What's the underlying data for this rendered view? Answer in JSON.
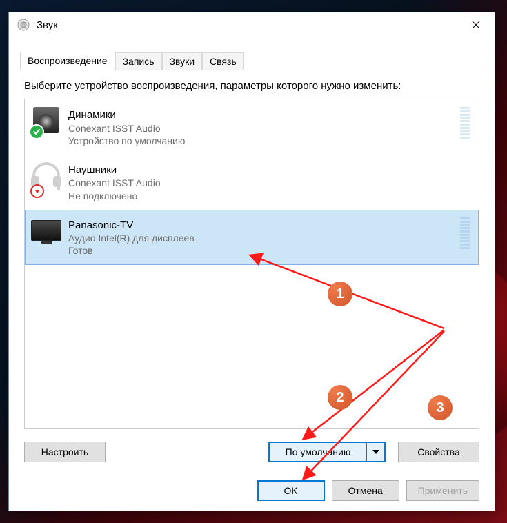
{
  "window": {
    "title": "Звук"
  },
  "tabs": {
    "items": [
      {
        "label": "Воспроизведение",
        "active": true
      },
      {
        "label": "Запись",
        "active": false
      },
      {
        "label": "Звуки",
        "active": false
      },
      {
        "label": "Связь",
        "active": false
      }
    ]
  },
  "instruction": "Выберите устройство воспроизведения, параметры которого нужно изменить:",
  "devices": [
    {
      "name": "Динамики",
      "subtitle": "Conexant ISST Audio",
      "status": "Устройство по умолчанию",
      "icon": "speakers",
      "badge": "check",
      "selected": false
    },
    {
      "name": "Наушники",
      "subtitle": "Conexant ISST Audio",
      "status": "Не подключено",
      "icon": "headphones",
      "badge": "down",
      "selected": false
    },
    {
      "name": "Panasonic-TV",
      "subtitle": "Аудио Intel(R) для дисплеев",
      "status": "Готов",
      "icon": "tv",
      "badge": null,
      "selected": true
    }
  ],
  "buttons": {
    "configure": "Настроить",
    "set_default": "По умолчанию",
    "properties": "Свойства",
    "ok": "OK",
    "cancel": "Отмена",
    "apply": "Применить"
  },
  "annotations": {
    "1": "1",
    "2": "2",
    "3": "3"
  }
}
